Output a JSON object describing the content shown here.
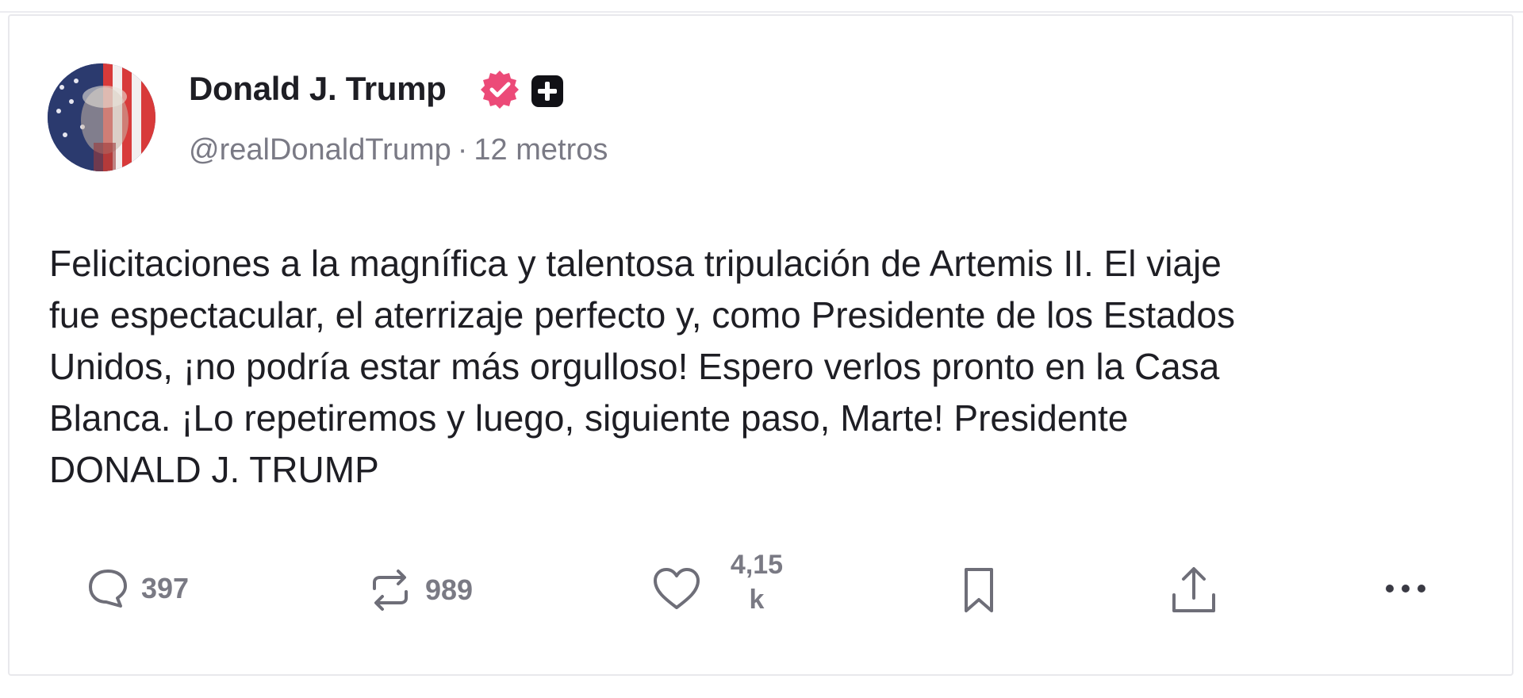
{
  "post": {
    "author": {
      "name": "Donald J. Trump",
      "handle": "@realDonaldTrump",
      "separator": "·",
      "time": "12 metros",
      "avatar_icon": "flag-portrait-avatar",
      "verified_icon": "verified-badge-icon",
      "verified_color": "#ec4a78",
      "extra_badge_icon": "plus-badge-icon"
    },
    "body": "Felicitaciones a la magnífica y talentosa tripulación de Artemis II. El viaje\nfue espectacular, el aterrizaje perfecto y, como Presidente de los Estados\nUnidos, ¡no podría estar más orgulloso! Espero verlos pronto en la Casa\nBlanca. ¡Lo repetiremos y luego, siguiente paso, Marte! Presidente\nDONALD J. TRUMP",
    "actions": {
      "replies": "397",
      "reposts": "989",
      "likes_line1": "4,15",
      "likes_line2": "k"
    }
  }
}
